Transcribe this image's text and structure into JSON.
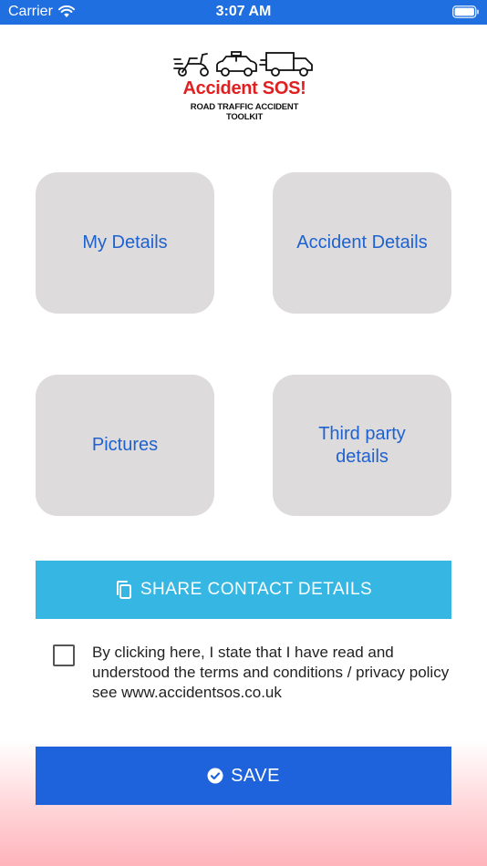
{
  "status_bar": {
    "carrier": "Carrier",
    "time": "3:07 AM"
  },
  "logo": {
    "brand": "Accident SOS!",
    "tagline": "ROAD TRAFFIC ACCIDENT TOOLKIT"
  },
  "tiles": [
    {
      "label": "My Details"
    },
    {
      "label": "Accident Details"
    },
    {
      "label": "Pictures"
    },
    {
      "label": "Third party details"
    }
  ],
  "share": {
    "label": "SHARE CONTACT DETAILS",
    "icon": "copy-icon"
  },
  "terms": {
    "checked": false,
    "line1": "By clicking here, I state that I have read and understood the terms and conditions / privacy policy",
    "line2": "see www.accidentsos.co.uk"
  },
  "save": {
    "label": "SAVE",
    "icon": "check-circle-icon"
  },
  "colors": {
    "status_bar": "#1f6fe0",
    "tile_bg": "#dddbdc",
    "tile_text": "#1e62cf",
    "share_button": "#35b6e3",
    "save_button": "#1e62dc",
    "brand_red": "#e02020"
  }
}
